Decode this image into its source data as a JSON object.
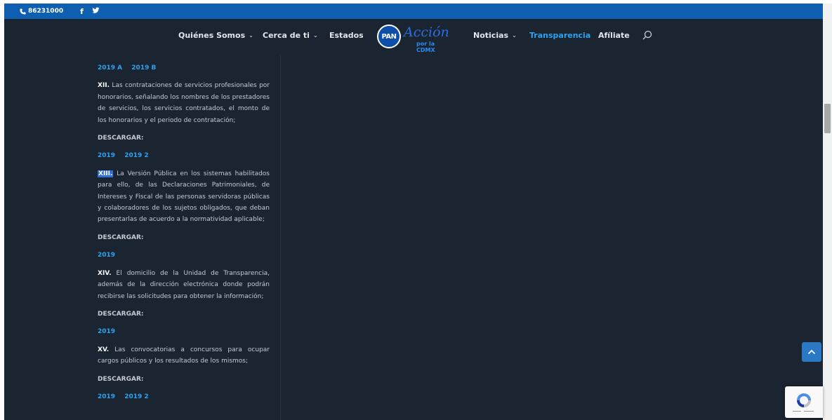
{
  "topbar": {
    "phone": "86231000",
    "facebook_glyph": "f",
    "twitter_glyph": "🐦"
  },
  "nav": {
    "quienes": "Quiénes Somos",
    "cerca": "Cerca de ti",
    "estados": "Estados",
    "noticias": "Noticias",
    "transparencia": "Transparencia",
    "afiliate": "Afíliate",
    "chevron": "⌄"
  },
  "logo": {
    "badge": "PAN",
    "script": "Acción",
    "sub": "por la CDMX"
  },
  "colors": {
    "topbar": "#0f5fb0",
    "background": "#1b2431",
    "link": "#2ea3f2"
  },
  "content": {
    "links_2019ab": [
      "2019 A",
      "2019 B"
    ],
    "xii_num": "XII.",
    "xii_text": " Las contrataciones de servicios profesionales por honorarios, señalando los nombres de los prestadores de servicios, los servicios contratados, el monto de los honorarios y el periodo de contratación;",
    "descargar": "DESCARGAR:",
    "links_xii": [
      "2019",
      "2019 2"
    ],
    "xiii_num": "XIII.",
    "xiii_text": " La Versión Pública en los sistemas habilitados para ello, de las Declaraciones Patrimoniales, de Intereses y Fiscal de las personas servidoras públicas y colaboradores de los sujetos obligados, que deban presentarlas de acuerdo a la normatividad aplicable;",
    "links_xiii": [
      "2019"
    ],
    "xiv_num": "XIV.",
    "xiv_text": " El domicilio de la Unidad de Transparencia, además de la dirección electrónica donde podrán recibirse las solicitudes para obtener la información;",
    "links_xiv": [
      "2019"
    ],
    "xv_num": "XV.",
    "xv_text": " Las convocatorias a concursos para ocupar cargos públicos y los resultados de los mismos;",
    "links_xv": [
      "2019",
      "2019 2"
    ]
  }
}
